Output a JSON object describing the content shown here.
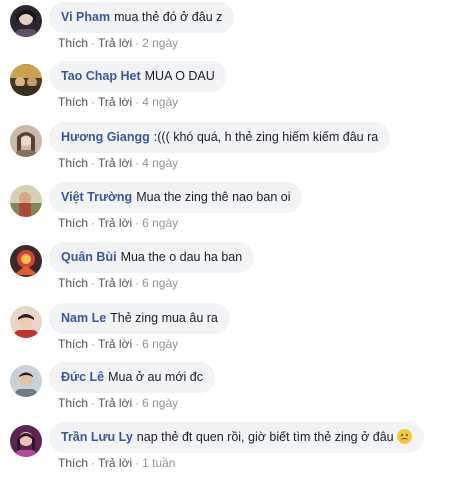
{
  "comments": [
    {
      "author": "Vi Pham",
      "text": "mua thẻ đó ở đâu z",
      "like": "Thích",
      "reply": "Trả lời",
      "time": "2 ngày",
      "avatar_color": "#3a3340",
      "emoji": false
    },
    {
      "author": "Tao Chap Het",
      "text": "MUA O DAU",
      "like": "Thích",
      "reply": "Trả lời",
      "time": "4 ngày",
      "avatar_color": "#6d5a2e",
      "emoji": false
    },
    {
      "author": "Hương Giangg",
      "text": ":((( khó quá, h thẻ zing hiếm kiếm đâu ra",
      "like": "Thích",
      "reply": "Trả lời",
      "time": "4 ngày",
      "avatar_color": "#b79f8c",
      "emoji": false
    },
    {
      "author": "Việt Trường",
      "text": "Mua the zing thê nao ban oi",
      "like": "Thích",
      "reply": "Trả lời",
      "time": "6 ngày",
      "avatar_color": "#8c7a5a",
      "emoji": false
    },
    {
      "author": "Quân Bùi",
      "text": "Mua the o dau ha ban",
      "like": "Thích",
      "reply": "Trả lời",
      "time": "6 ngày",
      "avatar_color": "#b8322c",
      "emoji": false
    },
    {
      "author": "Nam Le",
      "text": "Thẻ zing mua âu ra",
      "like": "Thích",
      "reply": "Trả lời",
      "time": "6 ngày",
      "avatar_color": "#c0392b",
      "emoji": false
    },
    {
      "author": "Đức Lê",
      "text": "Mua ở au mới đc",
      "like": "Thích",
      "reply": "Trả lời",
      "time": "6 ngày",
      "avatar_color": "#9aa3ad",
      "emoji": false
    },
    {
      "author": "Trần Lưu Ly",
      "text": "nap thẻ đt quen rồi, giờ biết tìm thẻ zing ở đâu",
      "like": "Thích",
      "reply": "Trả lời",
      "time": "1 tuần",
      "avatar_color": "#7b2a6a",
      "emoji": true
    }
  ],
  "colors": {
    "author": "#385898",
    "bubble": "#f2f3f5",
    "meta": "#90949c"
  }
}
